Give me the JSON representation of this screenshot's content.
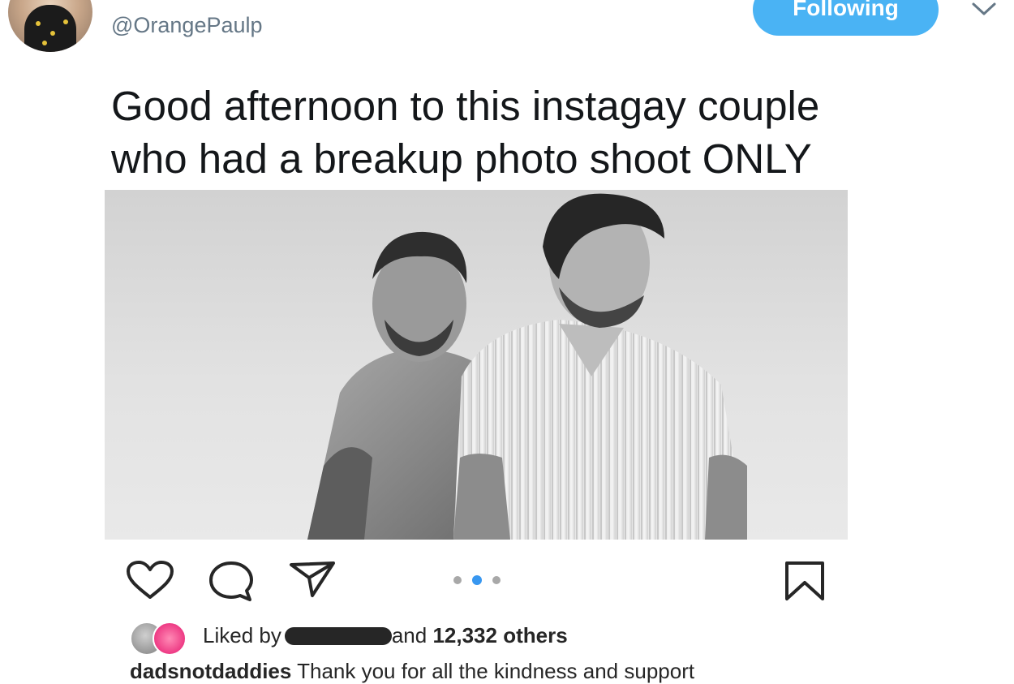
{
  "tweet": {
    "handle": "@OrangePaulp",
    "follow_label": "Following",
    "text_line1": "Good afternoon to this instagay couple",
    "text_line2": "who had a breakup photo shoot ONLY"
  },
  "icons": {
    "caret": "chevron-down-icon",
    "heart": "heart-icon",
    "comment": "comment-icon",
    "share": "share-icon",
    "bookmark": "bookmark-icon"
  },
  "instagram": {
    "carousel": {
      "count": 3,
      "active_index": 2
    },
    "liked_prefix": "Liked by",
    "liked_suffix_pre": "and ",
    "liked_suffix_count": "12,332 others",
    "caption_user": "dadsnotdaddies",
    "caption_text": " Thank you for all the kindness and support"
  },
  "colors": {
    "follow_button": "#4ab3f4",
    "handle_gray": "#657786",
    "active_dot": "#3897f0"
  }
}
